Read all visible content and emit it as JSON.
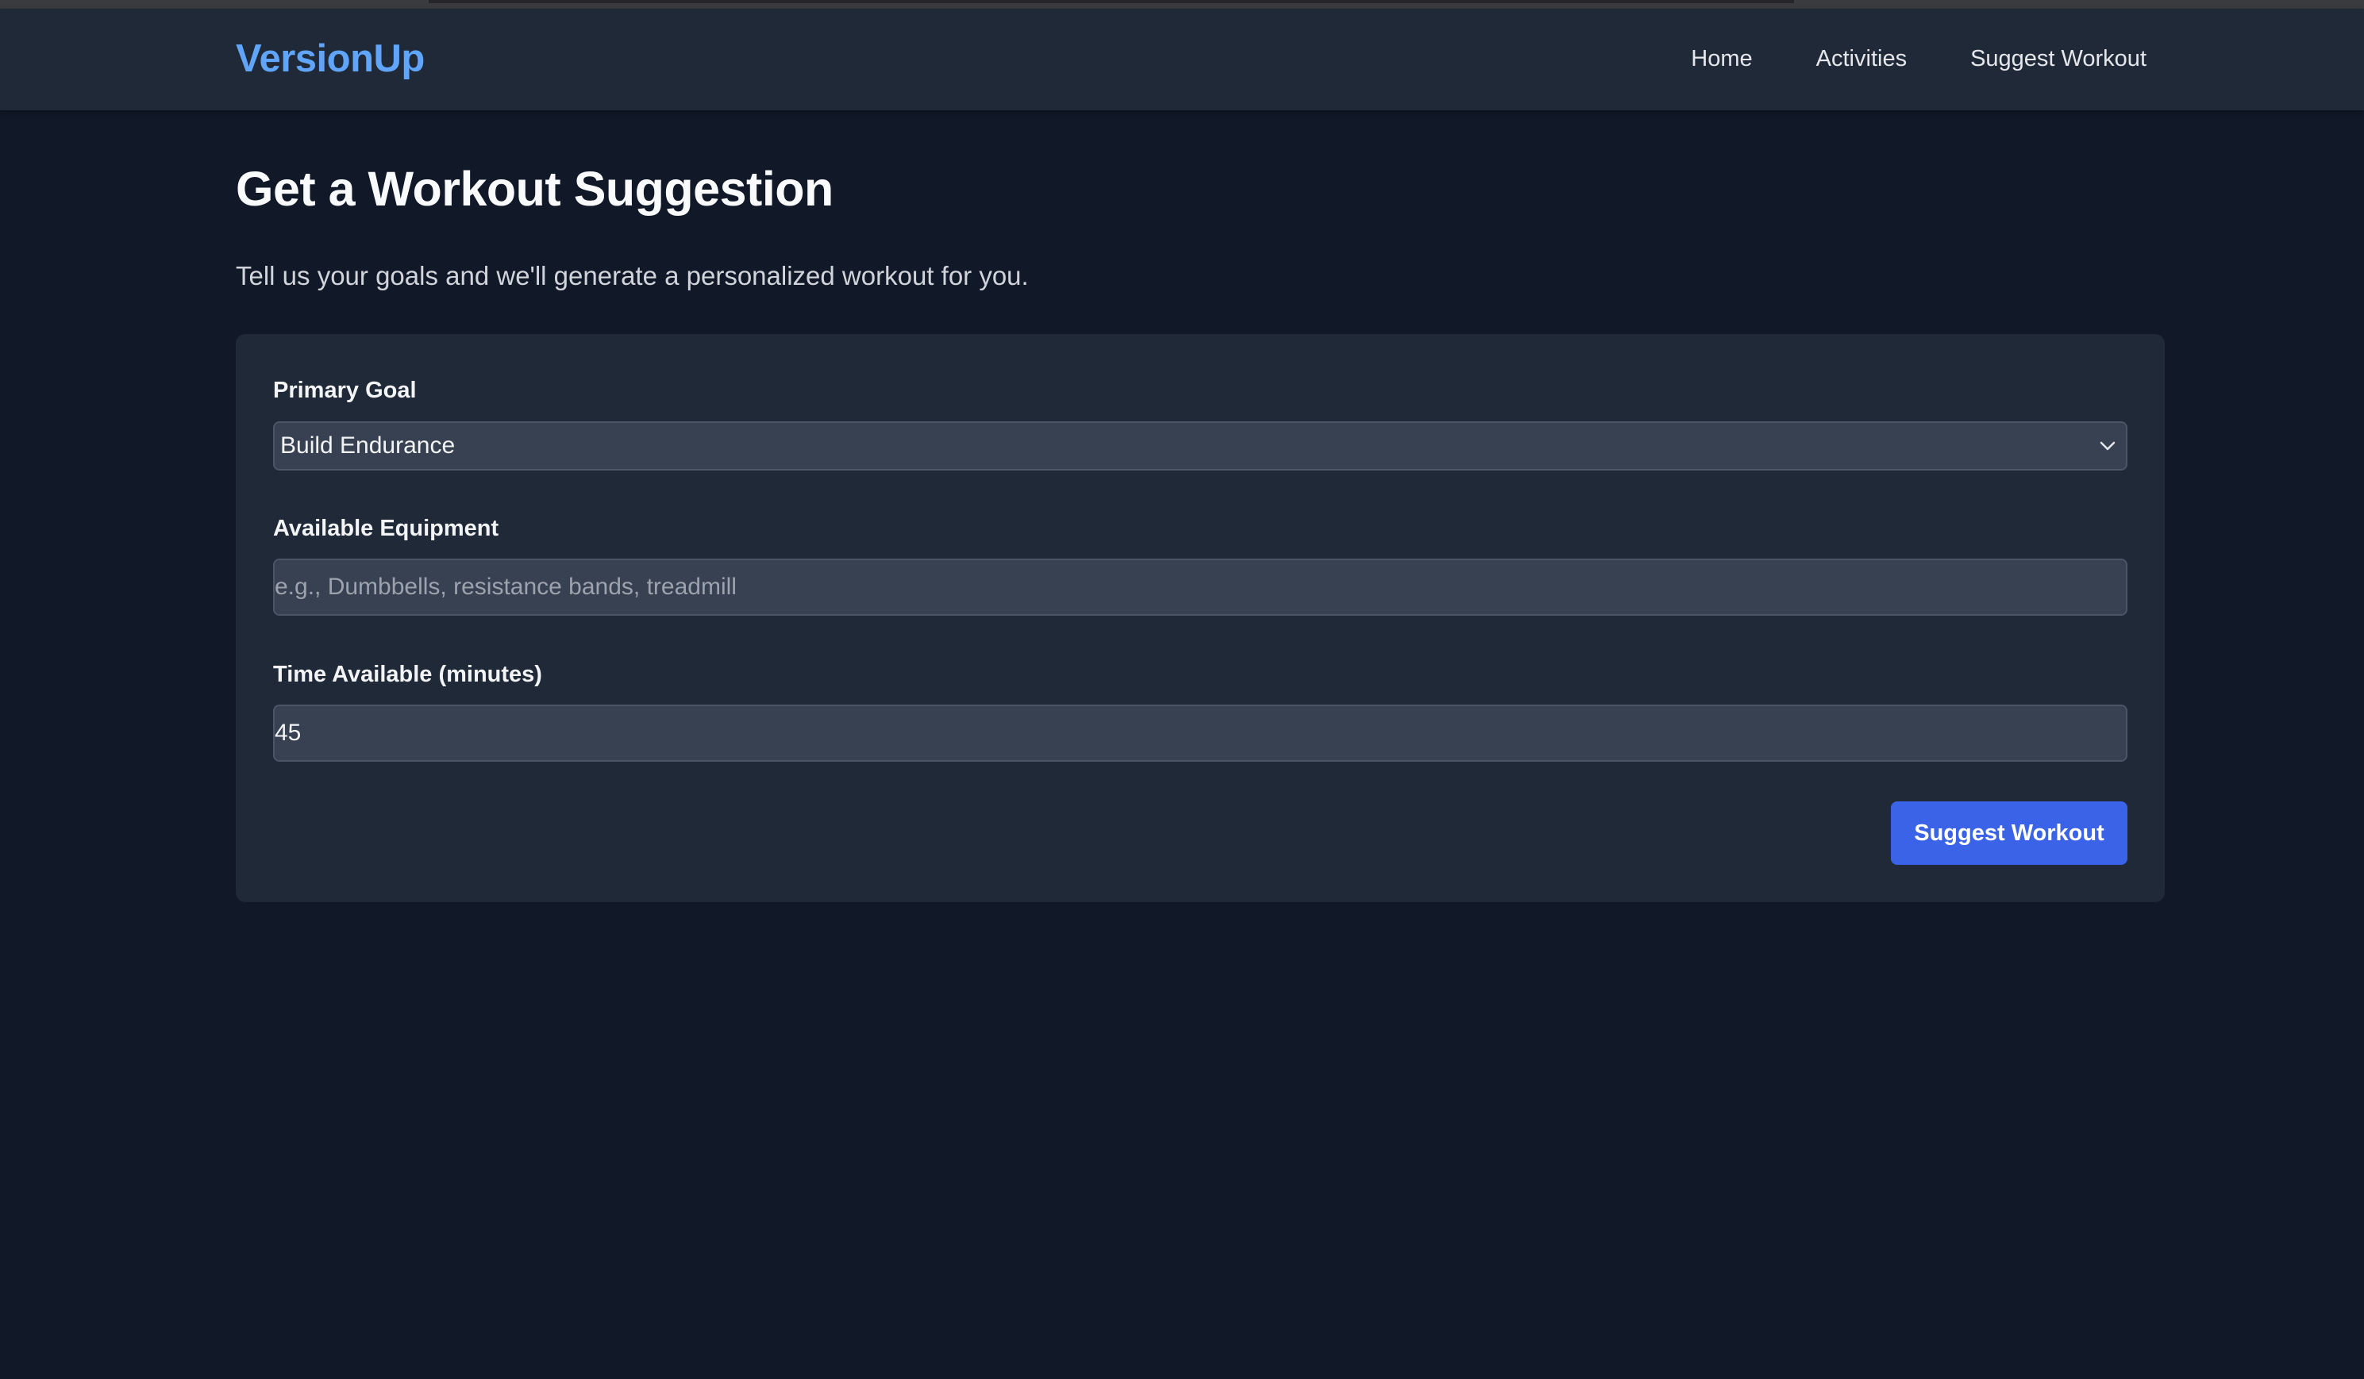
{
  "header": {
    "brand": "VersionUp",
    "nav": [
      {
        "label": "Home"
      },
      {
        "label": "Activities"
      },
      {
        "label": "Suggest Workout"
      }
    ]
  },
  "page": {
    "title": "Get a Workout Suggestion",
    "subtitle": "Tell us your goals and we'll generate a personalized workout for you."
  },
  "form": {
    "goal": {
      "label": "Primary Goal",
      "selected": "Build Endurance",
      "icon": "chevron-down-icon"
    },
    "equipment": {
      "label": "Available Equipment",
      "value": "",
      "placeholder": "e.g., Dumbbells, resistance bands, treadmill"
    },
    "time": {
      "label": "Time Available (minutes)",
      "value": "45"
    },
    "submit_label": "Suggest Workout"
  },
  "colors": {
    "background": "#111827",
    "navbar": "#1f2937",
    "brand": "#60a5fa",
    "card": "#1f2937",
    "input": "#374151",
    "button": "#3b63e8"
  }
}
